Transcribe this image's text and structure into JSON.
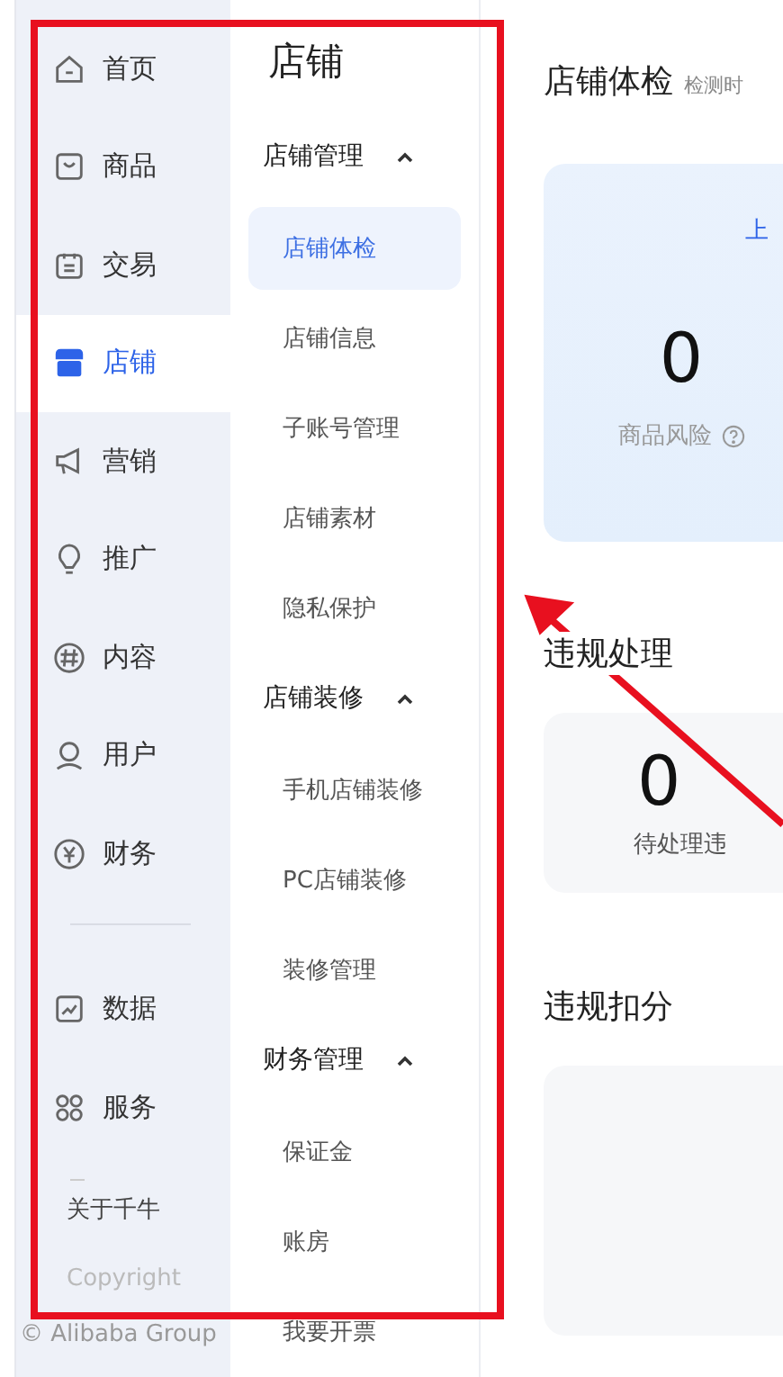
{
  "nav": {
    "groups": [
      {
        "items": [
          {
            "label": "首页",
            "selected": false
          },
          {
            "label": "商品",
            "selected": false
          },
          {
            "label": "交易",
            "selected": false
          },
          {
            "label": "店铺",
            "selected": true
          },
          {
            "label": "营销",
            "selected": false
          },
          {
            "label": "推广",
            "selected": false
          },
          {
            "label": "内容",
            "selected": false
          },
          {
            "label": "用户",
            "selected": false
          },
          {
            "label": "财务",
            "selected": false
          }
        ]
      },
      {
        "items": [
          {
            "label": "数据",
            "selected": false
          },
          {
            "label": "服务",
            "selected": false
          }
        ]
      }
    ],
    "footer": [
      "关于千牛",
      "Copyright",
      "© Alibaba Group"
    ]
  },
  "submenu": {
    "title": "店铺",
    "groups": [
      {
        "label": "店铺管理",
        "expanded": true,
        "items": [
          {
            "label": "店铺体检",
            "selected": true
          },
          {
            "label": "店铺信息",
            "selected": false
          },
          {
            "label": "子账号管理",
            "selected": false
          },
          {
            "label": "店铺素材",
            "selected": false
          },
          {
            "label": "隐私保护",
            "selected": false
          }
        ]
      },
      {
        "label": "店铺装修",
        "expanded": true,
        "items": [
          {
            "label": "手机店铺装修",
            "selected": false
          },
          {
            "label": "PC店铺装修",
            "selected": false
          },
          {
            "label": "装修管理",
            "selected": false
          }
        ]
      },
      {
        "label": "财务管理",
        "expanded": true,
        "items": [
          {
            "label": "保证金",
            "selected": false
          },
          {
            "label": "账房",
            "selected": false
          },
          {
            "label": "我要开票",
            "selected": false
          }
        ]
      }
    ]
  },
  "main": {
    "sections": [
      {
        "title": "店铺体检",
        "note": "检测时",
        "kind": "checkup",
        "link": "上",
        "value": "0",
        "label": "商品风险"
      },
      {
        "title": "违规处理",
        "kind": "violations",
        "value": "0",
        "label": "待处理违"
      },
      {
        "title": "违规扣分",
        "kind": "points"
      }
    ]
  },
  "annotations": {
    "frame": true,
    "arrow": true
  }
}
